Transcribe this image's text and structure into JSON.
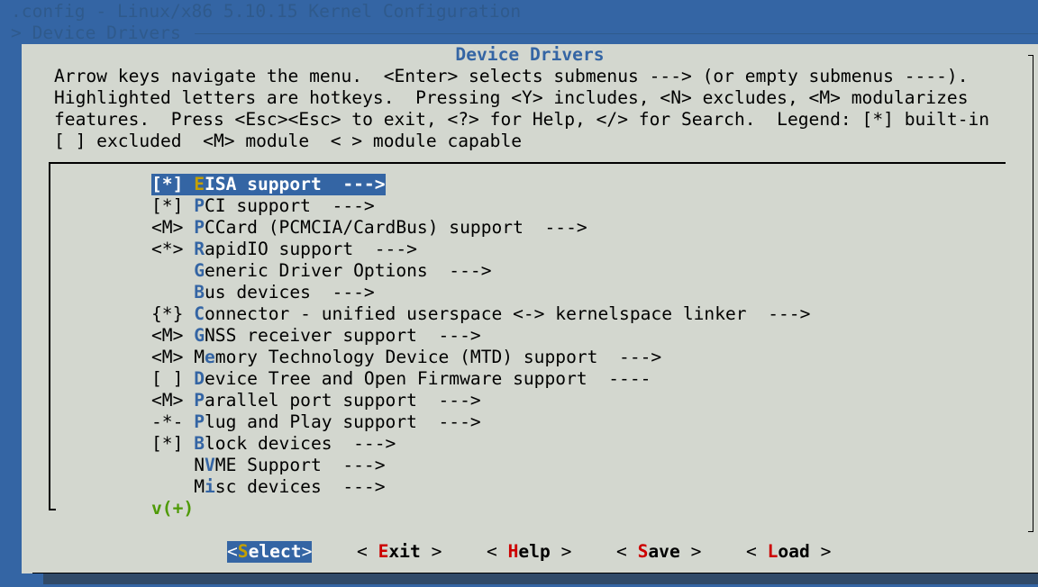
{
  "window": {
    "title": ".config - Linux/x86 5.10.15 Kernel Configuration",
    "breadcrumb": "> Device Drivers"
  },
  "dialog": {
    "title": "Device Drivers",
    "help_lines": [
      "Arrow keys navigate the menu.  <Enter> selects submenus ---> (or empty submenus ----).",
      "Highlighted letters are hotkeys.  Pressing <Y> includes, <N> excludes, <M> modularizes",
      "features.  Press <Esc><Esc> to exit, <?> for Help, </> for Search.  Legend: [*] built-in",
      "[ ] excluded  <M> module  < > module capable"
    ]
  },
  "menu": {
    "items": [
      {
        "state": "[*]",
        "hot": "E",
        "rest": "ISA support  --->"
      },
      {
        "state": "[*]",
        "hot": "P",
        "rest": "CI support  --->"
      },
      {
        "state": "<M>",
        "hot": "P",
        "rest": "CCard (PCMCIA/CardBus) support  --->"
      },
      {
        "state": "<*>",
        "hot": "R",
        "rest": "apidIO support  --->"
      },
      {
        "state": "   ",
        "hot": "G",
        "rest": "eneric Driver Options  --->"
      },
      {
        "state": "   ",
        "hot": "B",
        "rest": "us devices  --->"
      },
      {
        "state": "{*}",
        "hot": "C",
        "rest": "onnector - unified userspace <-> kernelspace linker  --->"
      },
      {
        "state": "<M>",
        "hot": "G",
        "rest": "NSS receiver support  --->"
      },
      {
        "state": "<M>",
        "pre": "M",
        "hot": "e",
        "rest": "mory Technology Device (MTD) support  --->"
      },
      {
        "state": "[ ]",
        "hot": "D",
        "rest": "evice Tree and Open Firmware support  ----"
      },
      {
        "state": "<M>",
        "hot": "P",
        "rest": "arallel port support  --->"
      },
      {
        "state": "-*-",
        "hot": "P",
        "rest": "lug and Play support  --->"
      },
      {
        "state": "[*]",
        "hot": "B",
        "rest": "lock devices  --->"
      },
      {
        "state": "   ",
        "pre": "N",
        "hot": "V",
        "rest": "ME Support  --->"
      },
      {
        "state": "   ",
        "pre": "M",
        "hot": "i",
        "rest": "sc devices  --->"
      }
    ],
    "more_indicator": "v(+)"
  },
  "buttons": [
    {
      "pre": "<",
      "hot": "S",
      "rest": "elect",
      "post": ">"
    },
    {
      "pre": "< ",
      "hot": "E",
      "rest": "xit",
      "post": " >"
    },
    {
      "pre": "< ",
      "hot": "H",
      "rest": "elp",
      "post": " >"
    },
    {
      "pre": "< ",
      "hot": "S",
      "rest": "ave",
      "post": " >"
    },
    {
      "pre": "< ",
      "hot": "L",
      "rest": "oad",
      "post": " >"
    }
  ],
  "colors": {
    "background": "#3465a4",
    "dialog": "#d3d7cf",
    "hotkey": "#3465a4",
    "selected_hotkey": "#c4a000",
    "button_hotkey": "#cc0000",
    "more_indicator": "#4e9a06"
  }
}
